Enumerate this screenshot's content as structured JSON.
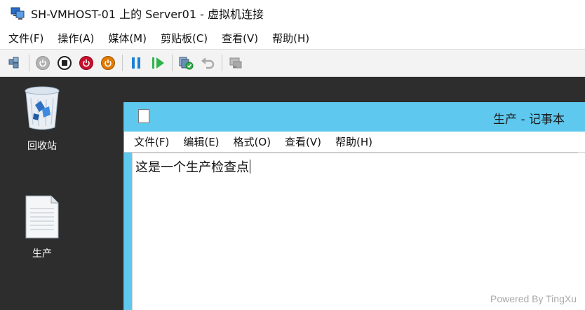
{
  "window": {
    "title": "SH-VMHOST-01 上的 Server01 - 虚拟机连接",
    "icon": "vm-connection-icon"
  },
  "menubar": {
    "items": [
      "文件(F)",
      "操作(A)",
      "媒体(M)",
      "剪贴板(C)",
      "查看(V)",
      "帮助(H)"
    ]
  },
  "toolbar": {
    "buttons": [
      {
        "icon": "ctrl-alt-del-icon"
      },
      {
        "icon": "start-icon"
      },
      {
        "icon": "turn-off-icon"
      },
      {
        "icon": "shutdown-icon"
      },
      {
        "icon": "power-save-icon"
      },
      {
        "icon": "pause-icon"
      },
      {
        "icon": "resume-icon"
      },
      {
        "icon": "checkpoint-icon"
      },
      {
        "icon": "revert-icon"
      },
      {
        "icon": "enhanced-session-icon"
      }
    ],
    "colors": {
      "red": "#c8102e",
      "orange": "#e07b00",
      "blue": "#1d7fd6",
      "green": "#2fb34a",
      "gray": "#9a9a9a"
    }
  },
  "desktop": {
    "background": "#2d2d2d",
    "icons": [
      {
        "label": "回收站",
        "icon": "recycle-bin-icon"
      },
      {
        "label": "生产",
        "icon": "text-file-icon"
      }
    ]
  },
  "notepad": {
    "title": "生产 - 记事本",
    "menu": [
      "文件(F)",
      "编辑(E)",
      "格式(O)",
      "查看(V)",
      "帮助(H)"
    ],
    "content": "这是一个生产检查点",
    "accent": "#5ec8ee"
  },
  "watermark": "Powered By TingXu"
}
